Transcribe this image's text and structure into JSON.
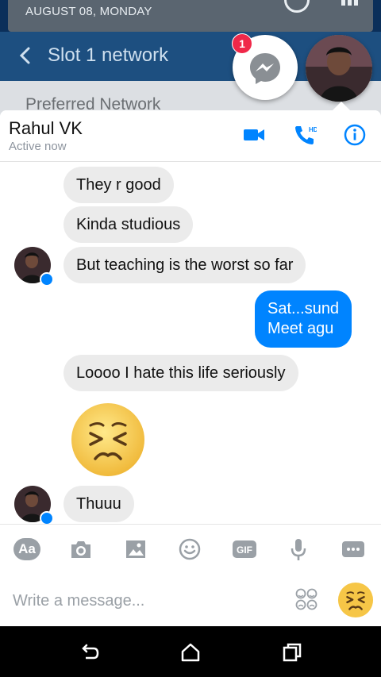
{
  "background": {
    "status_date": "AUGUST 08, MONDAY",
    "settings_title": "Slot 1 network",
    "settings_item": "Preferred Network"
  },
  "chathead": {
    "unread_count": "1",
    "icons": [
      "messenger-icon",
      "contact-avatar"
    ]
  },
  "header": {
    "contact_name": "Rahul VK",
    "status": "Active now",
    "call_hd_label": "HD",
    "icons": [
      "video-call-icon",
      "phone-hd-icon",
      "info-icon"
    ]
  },
  "messages": [
    {
      "sender": "them",
      "text": "They r good"
    },
    {
      "sender": "them",
      "text": "Kinda studious"
    },
    {
      "sender": "them",
      "text": "But teaching is the worst so far"
    },
    {
      "sender": "me",
      "lines": [
        "Sat...sund",
        "Meet agu"
      ]
    },
    {
      "sender": "them",
      "text": "Loooo I hate this life seriously"
    },
    {
      "sender": "them",
      "emoji": "persevering-face"
    },
    {
      "sender": "them",
      "text": "Thuuu"
    }
  ],
  "toolbar": {
    "aa_label": "Aa",
    "gif_label": "GIF",
    "icons": [
      "camera-icon",
      "image-icon",
      "smiley-icon",
      "gif-icon",
      "mic-icon",
      "more-icon"
    ]
  },
  "composer": {
    "placeholder": "Write a message..."
  },
  "colors": {
    "accent": "#0084ff",
    "them_bubble": "#ebebeb",
    "badge": "#f02849"
  }
}
